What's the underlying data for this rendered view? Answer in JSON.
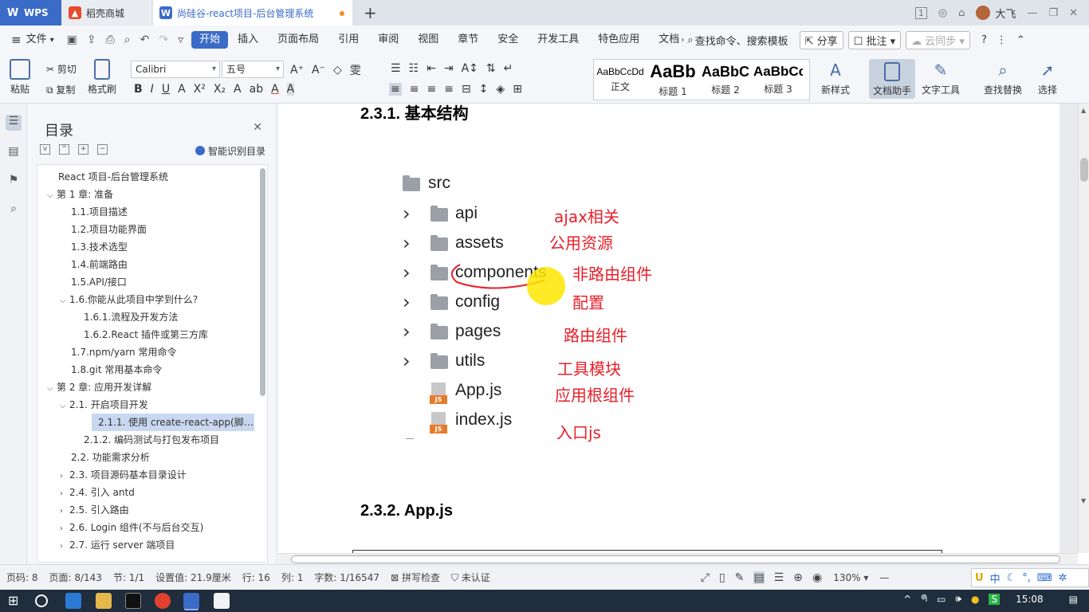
{
  "titlebar": {
    "tabs": [
      {
        "label": "WPS"
      },
      {
        "label": "稻壳商城"
      },
      {
        "label": "尚硅谷-react项目-后台管理系统"
      }
    ],
    "user_name": "大飞",
    "badge": "1"
  },
  "menubar": {
    "file": "文件",
    "items": [
      "开始",
      "插入",
      "页面布局",
      "引用",
      "审阅",
      "视图",
      "章节",
      "安全",
      "开发工具",
      "特色应用",
      "文档"
    ],
    "search": "查找命令、搜索模板",
    "share": "分享",
    "comment": "批注",
    "cloud": "云同步"
  },
  "ribbon": {
    "paste": "粘贴",
    "cut": "剪切",
    "copy": "复制",
    "format_painter": "格式刷",
    "font": "Calibri",
    "font_size": "五号",
    "styles": [
      {
        "preview": "AaBbCcDd",
        "name": "正文"
      },
      {
        "preview": "AaBb",
        "name": "标题 1"
      },
      {
        "preview": "AaBbC",
        "name": "标题 2"
      },
      {
        "preview": "AaBbCc",
        "name": "标题 3"
      }
    ],
    "new_style": "新样式",
    "doc_assistant": "文档助手",
    "text_tools": "文字工具",
    "find_replace": "查找替换",
    "select": "选择"
  },
  "toc": {
    "title": "目录",
    "smart": "智能识别目录",
    "items": [
      {
        "label": "React 项目-后台管理系统",
        "level": 0,
        "chev": ""
      },
      {
        "label": "第 1 章: 准备",
        "level": 0,
        "chev": "v"
      },
      {
        "label": "1.1.项目描述",
        "level": 1,
        "chev": ""
      },
      {
        "label": "1.2.项目功能界面",
        "level": 1,
        "chev": ""
      },
      {
        "label": "1.3.技术选型",
        "level": 1,
        "chev": ""
      },
      {
        "label": "1.4.前端路由",
        "level": 1,
        "chev": ""
      },
      {
        "label": "1.5.API/接口",
        "level": 1,
        "chev": ""
      },
      {
        "label": "1.6.你能从此项目中学到什么?",
        "level": 1,
        "chev": "v"
      },
      {
        "label": "1.6.1.流程及开发方法",
        "level": 2,
        "chev": ""
      },
      {
        "label": "1.6.2.React 插件或第三方库",
        "level": 2,
        "chev": ""
      },
      {
        "label": "1.7.npm/yarn 常用命令",
        "level": 1,
        "chev": ""
      },
      {
        "label": "1.8.git 常用基本命令",
        "level": 1,
        "chev": ""
      },
      {
        "label": "第 2 章: 应用开发详解",
        "level": 0,
        "chev": "v"
      },
      {
        "label": "2.1. 开启项目开发",
        "level": 1,
        "chev": "v"
      },
      {
        "label": "2.1.1. 使用 create-react-app(脚手…",
        "level": 2,
        "chev": "",
        "selected": true
      },
      {
        "label": "2.1.2. 编码测试与打包发布项目",
        "level": 2,
        "chev": ""
      },
      {
        "label": "2.2. 功能需求分析",
        "level": 1,
        "chev": ""
      },
      {
        "label": "2.3. 项目源码基本目录设计",
        "level": 1,
        "chev": ">"
      },
      {
        "label": "2.4. 引入 antd",
        "level": 1,
        "chev": ">"
      },
      {
        "label": "2.5. 引入路由",
        "level": 1,
        "chev": ">"
      },
      {
        "label": "2.6. Login 组件(不与后台交互)",
        "level": 1,
        "chev": ">"
      },
      {
        "label": "2.7. 运行 server 端项目",
        "level": 1,
        "chev": ">"
      }
    ]
  },
  "document": {
    "heading_top": "2.3.1. 基本结构",
    "tree": {
      "root": "src",
      "folders": [
        "api",
        "assets",
        "components",
        "config",
        "pages",
        "utils"
      ],
      "files": [
        "App.js",
        "index.js"
      ]
    },
    "annotations": [
      "ajax相关",
      "公用资源",
      "非路由组件",
      "配置",
      "路由组件",
      "工具模块",
      "应用根组件",
      "入口js"
    ],
    "heading_bottom": "2.3.2. App.js"
  },
  "statusbar": {
    "page_num": "页码: 8",
    "pages": "页面: 8/143",
    "section": "节: 1/1",
    "setting": "设置值: 21.9厘米",
    "row": "行: 16",
    "col": "列: 1",
    "words": "字数: 1/16547",
    "spell": "拼写检查",
    "cert": "未认证",
    "zoom": "130%"
  },
  "taskbar": {
    "time": "15:08",
    "ime": "中"
  }
}
